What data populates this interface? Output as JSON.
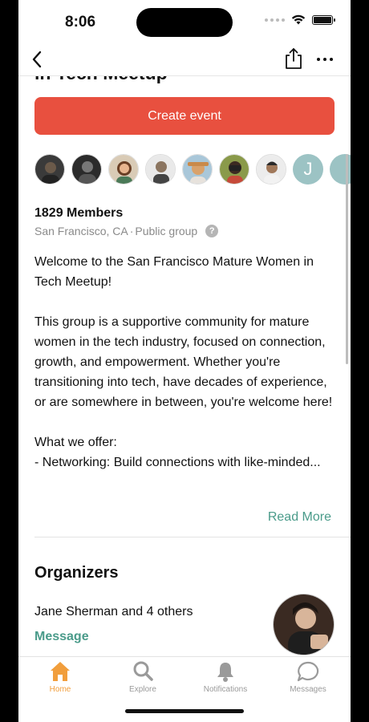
{
  "status_bar": {
    "time": "8:06"
  },
  "nav": {
    "icons": [
      "back-icon",
      "share-icon",
      "more-icon"
    ]
  },
  "group": {
    "title_cutoff": "in Tech Meetup",
    "create_event_label": "Create event",
    "extra_member_initial": "J",
    "member_count": "1829 Members",
    "location": "San Francisco, CA",
    "separator": "·",
    "privacy": "Public group",
    "help_glyph": "?",
    "description": "Welcome to the San Francisco Mature Women in Tech Meetup!\n\nThis group is a supportive community for mature women in the tech industry, focused on connection, growth, and empowerment. Whether you're transitioning into tech, have decades of experience, or are somewhere in between, you're welcome here!\n\nWhat we offer:\n- Networking: Build connections with like-minded...",
    "read_more": "Read More"
  },
  "organizers": {
    "title": "Organizers",
    "names": "Jane Sherman and 4 others",
    "message_label": "Message"
  },
  "tabs": [
    {
      "label": "Home",
      "icon": "home-icon",
      "active": true
    },
    {
      "label": "Explore",
      "icon": "search-icon",
      "active": false
    },
    {
      "label": "Notifications",
      "icon": "bell-icon",
      "active": false
    },
    {
      "label": "Messages",
      "icon": "chat-bubble-icon",
      "active": false
    }
  ],
  "colors": {
    "accent_red": "#e8503f",
    "link_teal": "#4a9b8a",
    "tab_active": "#f19e3c",
    "tab_inactive": "#9a9a9a"
  }
}
